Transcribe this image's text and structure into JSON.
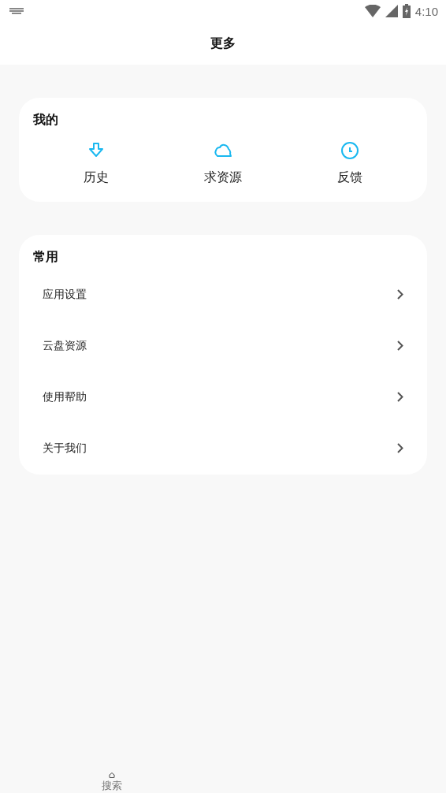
{
  "status_bar": {
    "time": "4:10"
  },
  "header": {
    "title": "更多"
  },
  "mine": {
    "title": "我的",
    "items": [
      {
        "kind": "download",
        "label": "历史"
      },
      {
        "kind": "cloud",
        "label": "求资源"
      },
      {
        "kind": "clock",
        "label": "反馈"
      }
    ]
  },
  "common": {
    "title": "常用",
    "items": [
      {
        "label": "应用设置"
      },
      {
        "label": "云盘资源"
      },
      {
        "label": "使用帮助"
      },
      {
        "label": "关于我们"
      }
    ]
  },
  "bottom_nav": {
    "tabs": [
      {
        "label": "搜索"
      }
    ]
  }
}
